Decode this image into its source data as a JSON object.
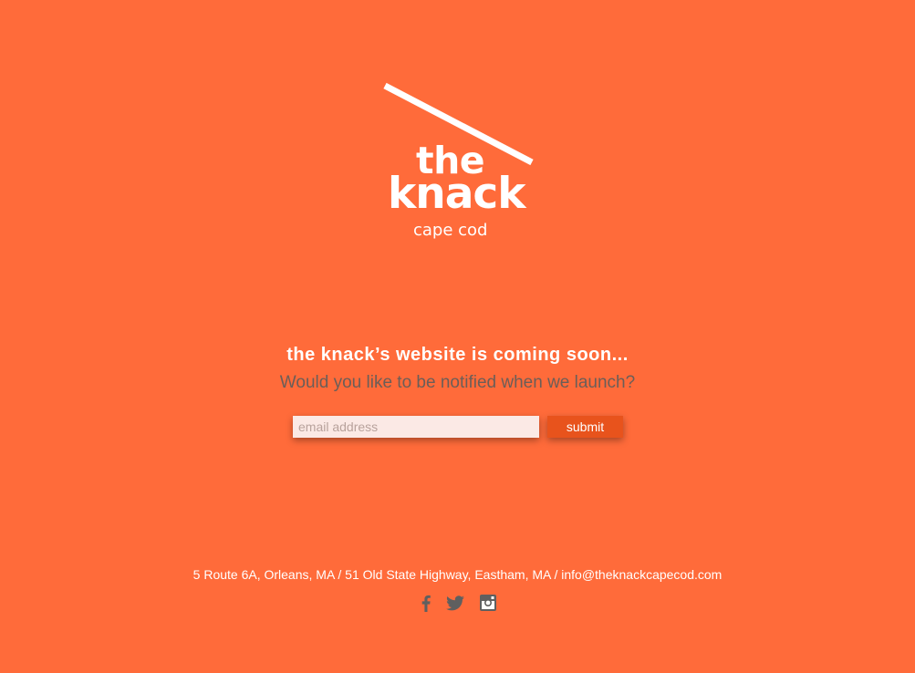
{
  "logo": {
    "line1": "the",
    "line2": "knack",
    "subtitle": "cape cod"
  },
  "hero": {
    "headline": "the knack’s website is coming soon...",
    "subline": "Would you like to be notified when we launch?"
  },
  "signup": {
    "email_placeholder": "email address",
    "email_value": "",
    "submit_label": "submit"
  },
  "footer": {
    "address": "5 Route 6A, Orleans, MA / 51 Old State Highway, Eastham, MA / info@theknackcapecod.com"
  },
  "social": {
    "icons": [
      "facebook-icon",
      "twitter-icon",
      "instagram-icon"
    ]
  },
  "colors": {
    "background": "#ff6b3a",
    "button": "#e8531c",
    "input": "#fbe9e5",
    "muted_text": "#6b5e58",
    "icon": "#5f5f5f"
  }
}
